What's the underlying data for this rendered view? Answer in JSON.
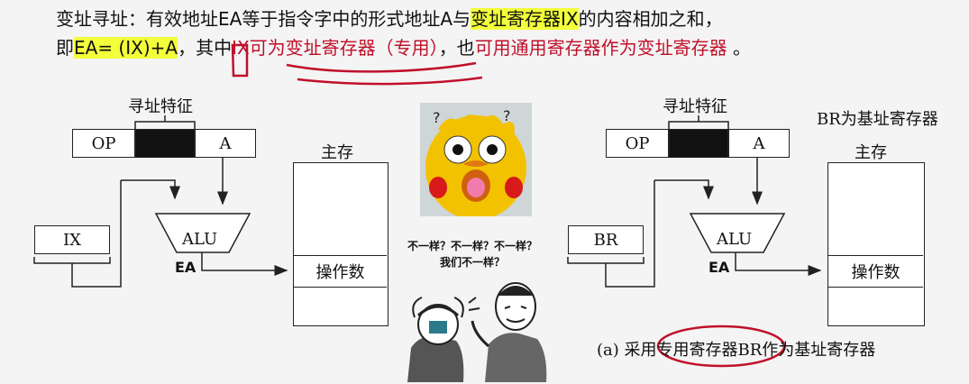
{
  "header": {
    "line1_a": "变址寻址：有效地址EA等于指令字中的形式地址A与",
    "line1_b": "变址寄存器IX",
    "line1_c": "的内容相加之和，",
    "line2_a": "即",
    "line2_b": "EA= (IX)+A",
    "line2_c": "，其中",
    "line2_d": "IX可为变址寄存器（专用）",
    "line2_e": "，也",
    "line2_f": "可用通用寄存器作为变址寄存器",
    "line2_g": " 。"
  },
  "left_diagram": {
    "feature_label": "寻址特征",
    "op": "OP",
    "a": "A",
    "ix": "IX",
    "alu": "ALU",
    "ea": "EA",
    "memory_label": "主存",
    "operand": "操作数"
  },
  "right_diagram": {
    "feature_label": "寻址特征",
    "br_note": "BR为基址寄存器",
    "op": "OP",
    "a": "A",
    "br": "BR",
    "alu": "ALU",
    "ea": "EA",
    "memory_label": "主存",
    "operand": "操作数",
    "caption": "(a) 采用专用寄存器BR作为基址寄存器"
  },
  "meme": {
    "line1": "不一样？不一样？不一样？",
    "line2": "我们不一样？"
  },
  "colors": {
    "highlight": "#f3ff3a",
    "annotation_red": "#c0102a",
    "chick_yellow": "#f2c200"
  }
}
